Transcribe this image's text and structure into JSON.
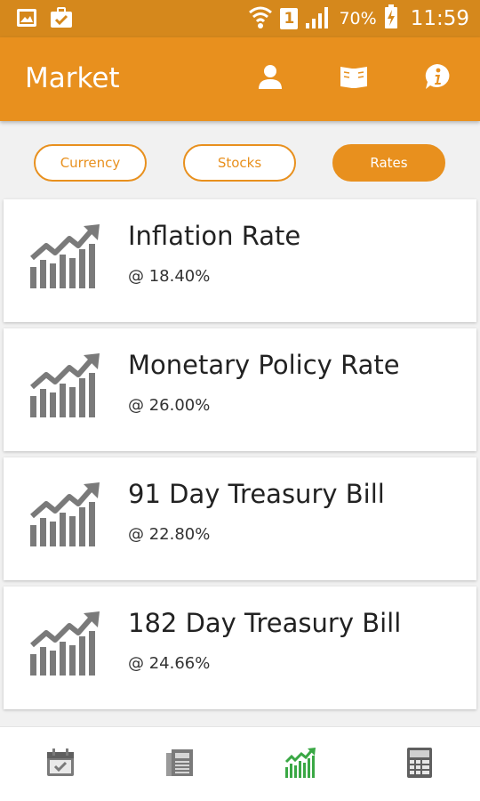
{
  "status_bar": {
    "battery": "70%",
    "sim": "1",
    "time": "11:59",
    "icons": [
      "image-icon",
      "briefcase-icon",
      "wifi-icon",
      "sim-icon",
      "signal-icon",
      "battery-charging-icon"
    ]
  },
  "app_bar": {
    "title": "Market",
    "actions": [
      "person-icon",
      "book-icon",
      "info-icon"
    ]
  },
  "tabs": [
    {
      "label": "Currency",
      "active": false
    },
    {
      "label": "Stocks",
      "active": false
    },
    {
      "label": "Rates",
      "active": true
    }
  ],
  "rates": [
    {
      "title": "Inflation Rate",
      "rate": "@ 18.40%"
    },
    {
      "title": "Monetary Policy Rate",
      "rate": "@ 26.00%"
    },
    {
      "title": "91 Day Treasury Bill",
      "rate": "@ 22.80%"
    },
    {
      "title": "182 Day Treasury Bill",
      "rate": "@ 24.66%"
    }
  ],
  "bottom_nav": {
    "items": [
      "calendar-icon",
      "newspaper-icon",
      "chart-icon",
      "calculator-icon"
    ],
    "active_index": 2
  },
  "colors": {
    "status_bar": "#d5881c",
    "accent": "#e8901e",
    "icon_gray": "#7a7a7a",
    "active_green": "#3aa845"
  }
}
